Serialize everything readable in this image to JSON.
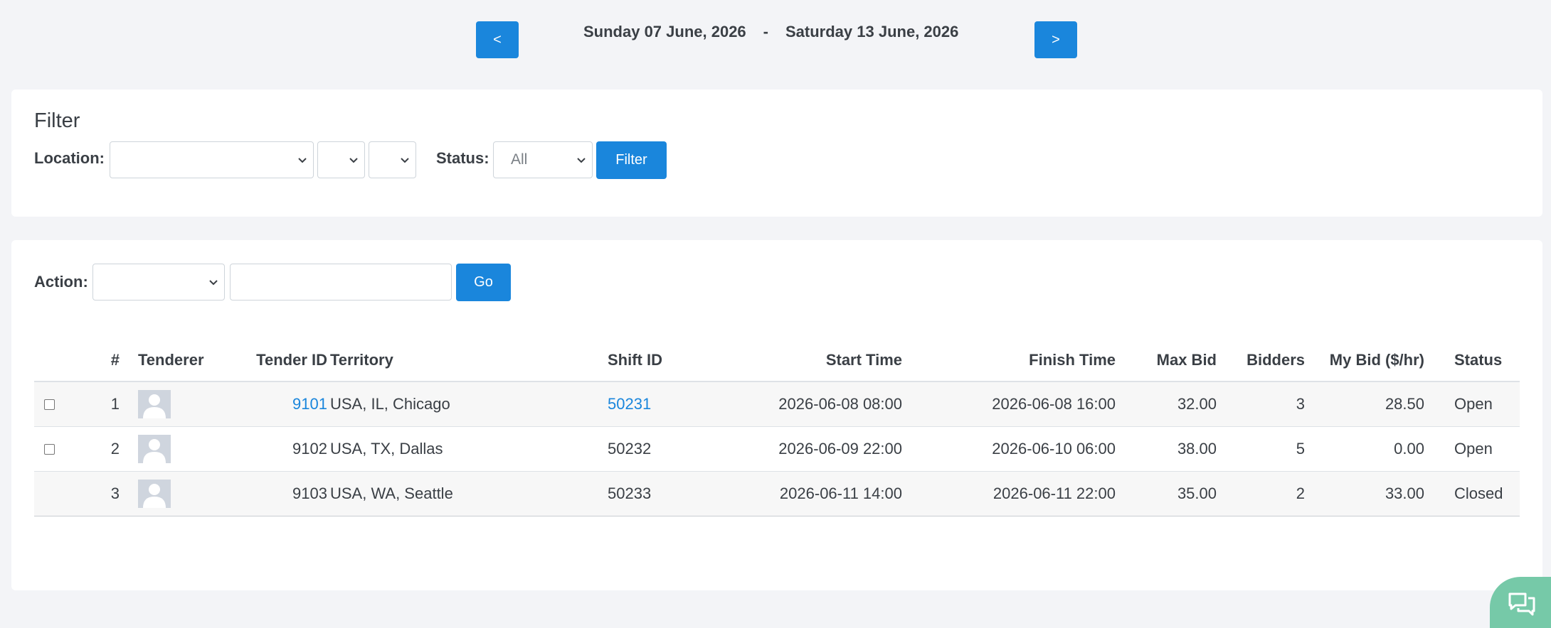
{
  "date_nav": {
    "prev_label": "<",
    "next_label": ">",
    "start_date": "Sunday 07 June, 2026",
    "separator": "-",
    "end_date": "Saturday 13 June, 2026"
  },
  "filter": {
    "title": "Filter",
    "location_label": "Location:",
    "location_value": "",
    "location_sub1_value": "",
    "location_sub2_value": "",
    "status_label": "Status:",
    "status_value": "All",
    "button_label": "Filter"
  },
  "action": {
    "label": "Action:",
    "select_value": "",
    "input_value": "",
    "button_label": "Go"
  },
  "table": {
    "columns": {
      "select": "",
      "index": "#",
      "tenderer": "Tenderer",
      "tender_id": "Tender ID",
      "territory": "Territory",
      "shift_id": "Shift ID",
      "start_time": "Start Time",
      "finish_time": "Finish Time",
      "max_bid": "Max Bid",
      "bidders": "Bidders",
      "my_bid": "My Bid ($/hr)",
      "status": "Status"
    },
    "rows": [
      {
        "has_checkbox": true,
        "index": "1",
        "tender_id": "9101",
        "tender_id_is_link": true,
        "territory": "USA, IL, Chicago",
        "shift_id": "50231",
        "shift_id_is_link": true,
        "start_time": "2026-06-08 08:00",
        "finish_time": "2026-06-08 16:00",
        "max_bid": "32.00",
        "bidders": "3",
        "my_bid": "28.50",
        "status": "Open"
      },
      {
        "has_checkbox": true,
        "index": "2",
        "tender_id": "9102",
        "tender_id_is_link": false,
        "territory": "USA, TX, Dallas",
        "shift_id": "50232",
        "shift_id_is_link": false,
        "start_time": "2026-06-09 22:00",
        "finish_time": "2026-06-10 06:00",
        "max_bid": "38.00",
        "bidders": "5",
        "my_bid": "0.00",
        "status": "Open"
      },
      {
        "has_checkbox": false,
        "index": "3",
        "tender_id": "9103",
        "tender_id_is_link": false,
        "territory": "USA, WA, Seattle",
        "shift_id": "50233",
        "shift_id_is_link": false,
        "start_time": "2026-06-11 14:00",
        "finish_time": "2026-06-11 22:00",
        "max_bid": "35.00",
        "bidders": "2",
        "my_bid": "33.00",
        "status": "Closed"
      }
    ]
  },
  "icons": {
    "avatar": "user-avatar-placeholder-icon",
    "select_arrow": "chevron-down-icon",
    "chat": "chat-bubbles-icon"
  },
  "colors": {
    "accent": "#1a86dc",
    "page_background": "#f3f4f7",
    "chat_widget": "#76c9a8"
  }
}
